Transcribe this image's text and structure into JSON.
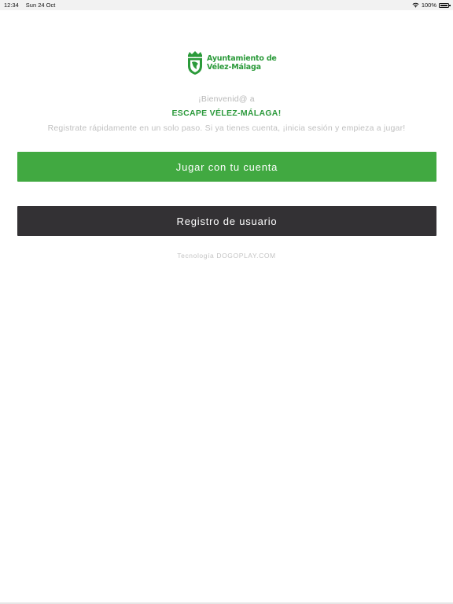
{
  "status_bar": {
    "time": "12:34",
    "date": "Sun 24 Oct",
    "battery": "100%",
    "icons": [
      "wifi-icon",
      "battery-icon"
    ]
  },
  "logo": {
    "line1": "Ayuntamiento de",
    "line2": "Vélez-Málaga",
    "icon": "coat-of-arms-icon",
    "color": "#2b9a3a"
  },
  "welcome": {
    "greeting": "¡Bienvenid@ a",
    "title": "ESCAPE VÉLEZ-MÁLAGA!",
    "subtitle": "Registrate rápidamente en un solo paso. Si ya tienes cuenta, ¡inicia sesión y empieza a jugar!"
  },
  "buttons": {
    "play_label": "Jugar con tu cuenta",
    "register_label": "Registro de usuario"
  },
  "footer": {
    "powered_by": "Tecnología DOGOPLAY.COM"
  },
  "colors": {
    "accent": "#41a941",
    "dark_button": "#333134",
    "title_green": "#2c9a3c"
  }
}
